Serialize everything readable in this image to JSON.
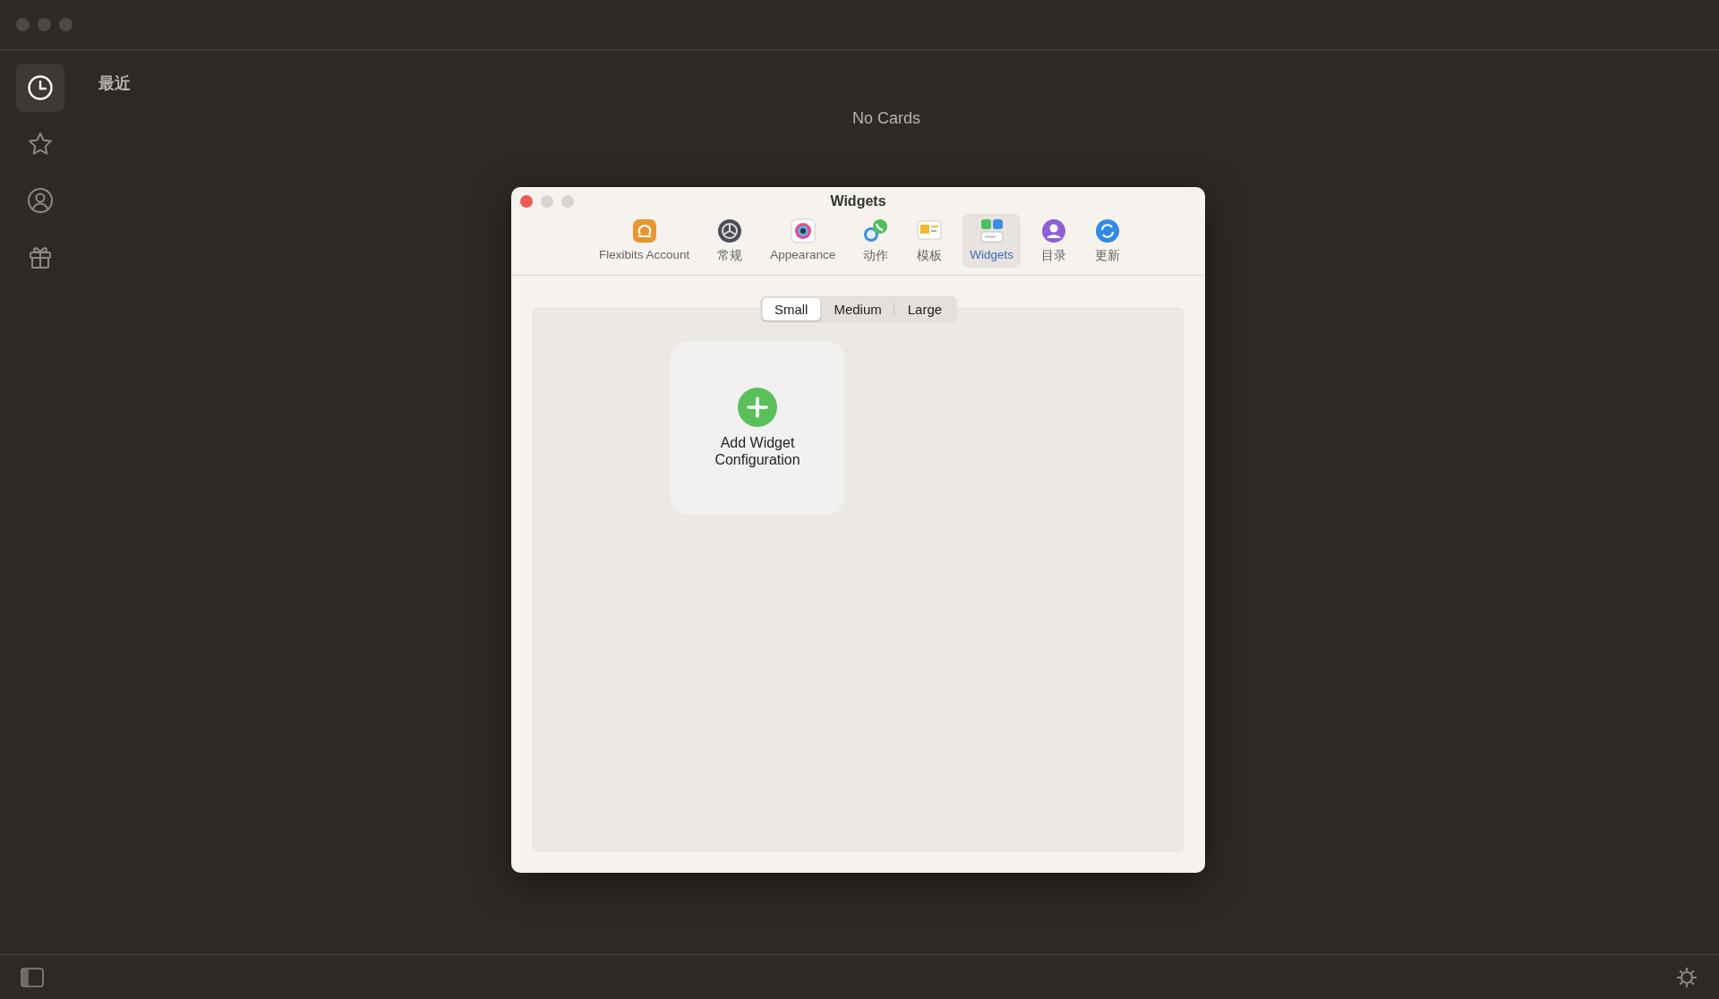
{
  "sidebar": {
    "items": [
      {
        "selected": true
      },
      {
        "selected": false
      },
      {
        "selected": false
      },
      {
        "selected": false
      }
    ]
  },
  "main": {
    "heading": "最近",
    "empty_message": "No Cards"
  },
  "dialog": {
    "title": "Widgets",
    "tabs": [
      {
        "label": "Flexibits Account",
        "selected": false
      },
      {
        "label": "常规",
        "selected": false
      },
      {
        "label": "Appearance",
        "selected": false
      },
      {
        "label": "动作",
        "selected": false
      },
      {
        "label": "模板",
        "selected": false
      },
      {
        "label": "Widgets",
        "selected": true
      },
      {
        "label": "目录",
        "selected": false
      },
      {
        "label": "更新",
        "selected": false
      }
    ],
    "sizes": [
      {
        "label": "Small",
        "selected": true
      },
      {
        "label": "Medium",
        "selected": false
      },
      {
        "label": "Large",
        "selected": false
      }
    ],
    "add_widget": {
      "label": "Add Widget Configuration"
    }
  }
}
